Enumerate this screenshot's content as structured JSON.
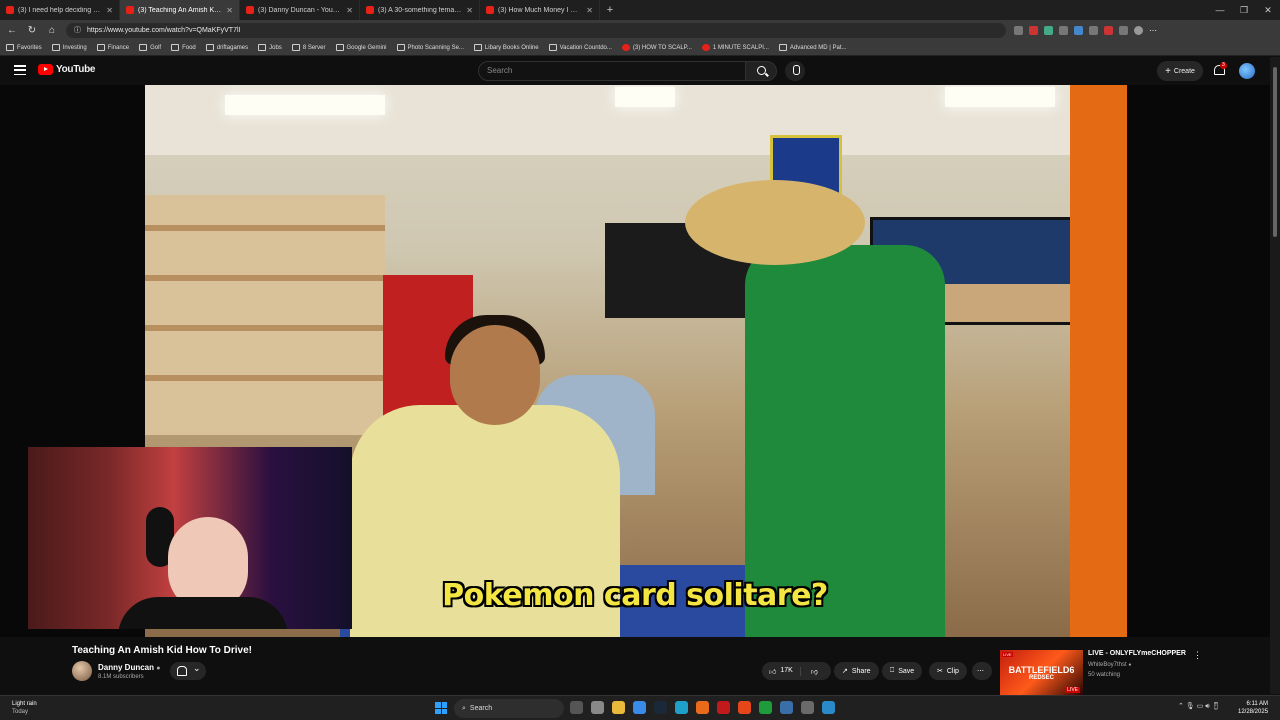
{
  "browser": {
    "tabs": [
      {
        "label": "(3) I need help deciding my next",
        "active": false
      },
      {
        "label": "(3) Teaching An Amish Kid H",
        "active": true
      },
      {
        "label": "(3) Danny Duncan - YouTube",
        "active": false
      },
      {
        "label": "(3) A 30-something female invest",
        "active": false
      },
      {
        "label": "(3) How Much Money I made Day",
        "active": false
      }
    ],
    "url": "https://www.youtube.com/watch?v=QMaKFyVT7lI",
    "bookmarks": [
      "Favorites",
      "Investing",
      "Finance",
      "Golf",
      "Food",
      "driftagames",
      "Jobs",
      "8 Server",
      "Google Gemini",
      "Photo Scanning Se...",
      "Libary Books Online",
      "Vacation Countdo...",
      "(3) HOW TO SCALP...",
      "1 MINUTE SCALPI...",
      "Advanced MD | Pat..."
    ]
  },
  "youtube": {
    "logo_text": "YouTube",
    "search_placeholder": "Search",
    "create_label": "Create",
    "notification_count": "3"
  },
  "video": {
    "caption": "Pokemon card solitare?",
    "title": "Teaching An Amish Kid How To Drive!",
    "channel": "Danny Duncan",
    "subscribers": "8.1M subscribers",
    "likes": "17K",
    "share_label": "Share",
    "save_label": "Save",
    "clip_label": "Clip"
  },
  "suggestion": {
    "title": "LIVE - ONLYFLYmeCHOPPER",
    "channel": "WhiteBoy7thst",
    "watching": "50 watching",
    "thumb_line1": "BATTLEFIELD6",
    "thumb_line2": "REDSEC",
    "live_tag": "LIVE"
  },
  "taskbar": {
    "weather": "Light rain",
    "weather_sub": "Today",
    "search_label": "Search",
    "time": "6:11 AM",
    "date": "12/28/2025"
  },
  "colors": {
    "brand": "#ff0000",
    "caption": "#f4e642"
  }
}
